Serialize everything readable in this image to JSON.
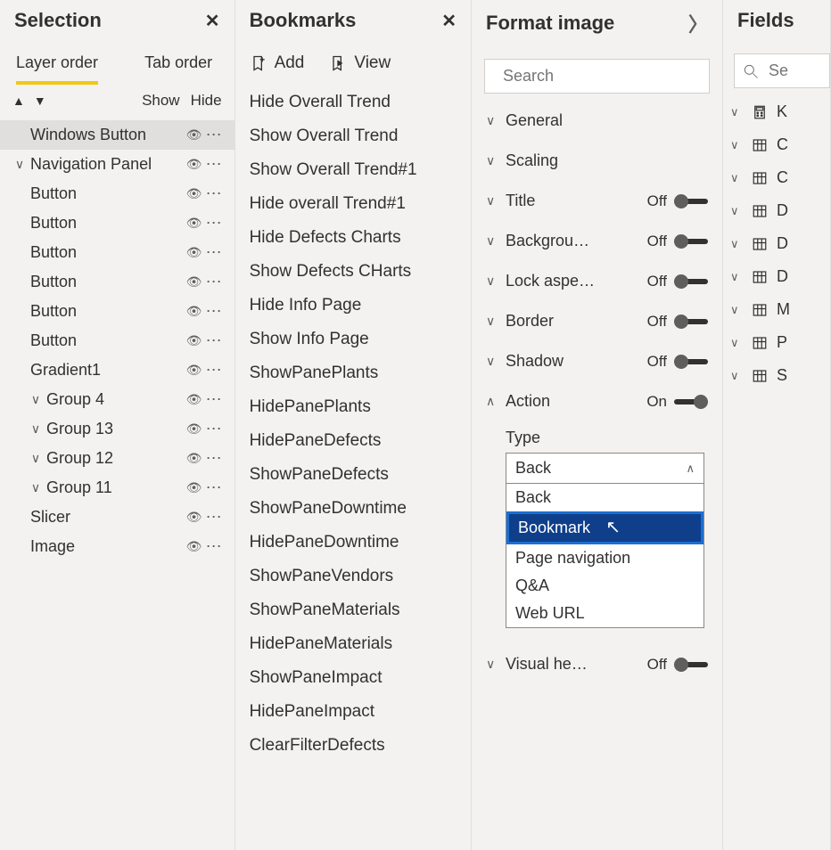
{
  "selection": {
    "title": "Selection",
    "tabs": {
      "layer": "Layer order",
      "tab": "Tab order",
      "active": "layer"
    },
    "showhide": {
      "show": "Show",
      "hide": "Hide"
    },
    "items": [
      {
        "label": "Windows Button",
        "expandable": false,
        "indent": 0,
        "selected": true
      },
      {
        "label": "Navigation Panel",
        "expandable": true,
        "indent": 0
      },
      {
        "label": "Button",
        "expandable": false,
        "indent": 0
      },
      {
        "label": "Button",
        "expandable": false,
        "indent": 0
      },
      {
        "label": "Button",
        "expandable": false,
        "indent": 0
      },
      {
        "label": "Button",
        "expandable": false,
        "indent": 0
      },
      {
        "label": "Button",
        "expandable": false,
        "indent": 0
      },
      {
        "label": "Button",
        "expandable": false,
        "indent": 0
      },
      {
        "label": "Gradient1",
        "expandable": false,
        "indent": 0
      },
      {
        "label": "Group 4",
        "expandable": true,
        "indent": 1
      },
      {
        "label": "Group 13",
        "expandable": true,
        "indent": 1
      },
      {
        "label": "Group 12",
        "expandable": true,
        "indent": 1
      },
      {
        "label": "Group 11",
        "expandable": true,
        "indent": 1
      },
      {
        "label": "Slicer",
        "expandable": false,
        "indent": 0
      },
      {
        "label": "Image",
        "expandable": false,
        "indent": 0
      }
    ]
  },
  "bookmarks": {
    "title": "Bookmarks",
    "toolbar": {
      "add": "Add",
      "view": "View"
    },
    "items": [
      "Hide Overall Trend",
      "Show Overall Trend",
      "Show Overall Trend#1",
      "Hide overall Trend#1",
      "Hide Defects Charts",
      "Show Defects CHarts",
      "Hide Info Page",
      "Show Info Page",
      "ShowPanePlants",
      "HidePanePlants",
      "HidePaneDefects",
      "ShowPaneDefects",
      "ShowPaneDowntime",
      "HidePaneDowntime",
      "ShowPaneVendors",
      "ShowPaneMaterials",
      "HidePaneMaterials",
      "ShowPaneImpact",
      "HidePaneImpact",
      "ClearFilterDefects"
    ]
  },
  "format": {
    "title": "Format image",
    "search_placeholder": "Search",
    "rows": [
      {
        "label": "General",
        "expanded": false,
        "toggle": null
      },
      {
        "label": "Scaling",
        "expanded": false,
        "toggle": null
      },
      {
        "label": "Title",
        "expanded": false,
        "toggle": "Off"
      },
      {
        "label": "Backgrou…",
        "expanded": false,
        "toggle": "Off"
      },
      {
        "label": "Lock aspe…",
        "expanded": false,
        "toggle": "Off"
      },
      {
        "label": "Border",
        "expanded": false,
        "toggle": "Off"
      },
      {
        "label": "Shadow",
        "expanded": false,
        "toggle": "Off"
      },
      {
        "label": "Action",
        "expanded": true,
        "toggle": "On"
      }
    ],
    "action": {
      "type_label": "Type",
      "selected": "Back",
      "options": [
        "Back",
        "Bookmark",
        "Page navigation",
        "Q&A",
        "Web URL"
      ],
      "highlighted": "Bookmark"
    },
    "visual_header": {
      "label": "Visual he…",
      "toggle": "Off"
    }
  },
  "fields": {
    "title": "Fields",
    "search_placeholder": "Se",
    "items": [
      {
        "label": "K",
        "icon": "calc"
      },
      {
        "label": "C",
        "icon": "table"
      },
      {
        "label": "C",
        "icon": "table"
      },
      {
        "label": "D",
        "icon": "table"
      },
      {
        "label": "D",
        "icon": "table"
      },
      {
        "label": "D",
        "icon": "table"
      },
      {
        "label": "M",
        "icon": "table"
      },
      {
        "label": "P",
        "icon": "table"
      },
      {
        "label": "S",
        "icon": "table"
      }
    ]
  }
}
